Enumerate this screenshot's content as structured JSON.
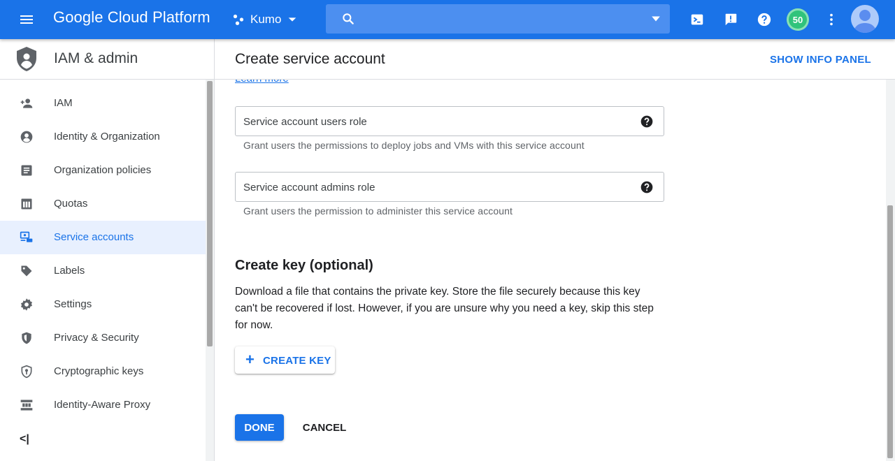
{
  "topbar": {
    "brand": "Google Cloud Platform",
    "project": "Kumo",
    "search_placeholder": "",
    "notifications_count": "50"
  },
  "sidebar": {
    "title": "IAM & admin",
    "items": [
      {
        "label": "IAM",
        "icon": "person-add-icon"
      },
      {
        "label": "Identity & Organization",
        "icon": "account-circle-icon"
      },
      {
        "label": "Organization policies",
        "icon": "document-list-icon"
      },
      {
        "label": "Quotas",
        "icon": "quota-meter-icon"
      },
      {
        "label": "Service accounts",
        "icon": "service-account-icon",
        "active": true
      },
      {
        "label": "Labels",
        "icon": "tag-icon"
      },
      {
        "label": "Settings",
        "icon": "gear-icon"
      },
      {
        "label": "Privacy & Security",
        "icon": "shield-icon"
      },
      {
        "label": "Cryptographic keys",
        "icon": "key-shield-icon"
      },
      {
        "label": "Identity-Aware Proxy",
        "icon": "proxy-icon"
      }
    ],
    "collapse_label": "<|"
  },
  "main": {
    "title": "Create service account",
    "info_panel": "SHOW INFO PANEL",
    "learn_more": "Learn more",
    "fields": [
      {
        "placeholder": "Service account users role",
        "hint": "Grant users the permissions to deploy jobs and VMs with this service account"
      },
      {
        "placeholder": "Service account admins role",
        "hint": "Grant users the permission to administer this service account"
      }
    ],
    "key_section": {
      "title": "Create key (optional)",
      "description": "Download a file that contains the private key. Store the file securely because this key can't be recovered if lost. However, if you are unsure why you need a key, skip this step for now.",
      "button": "CREATE KEY"
    },
    "done": "DONE",
    "cancel": "CANCEL"
  },
  "colors": {
    "accent": "#1a73e8",
    "topbar": "#1a73e8",
    "active_bg": "#e8f0fe",
    "badge": "#30c37b"
  }
}
